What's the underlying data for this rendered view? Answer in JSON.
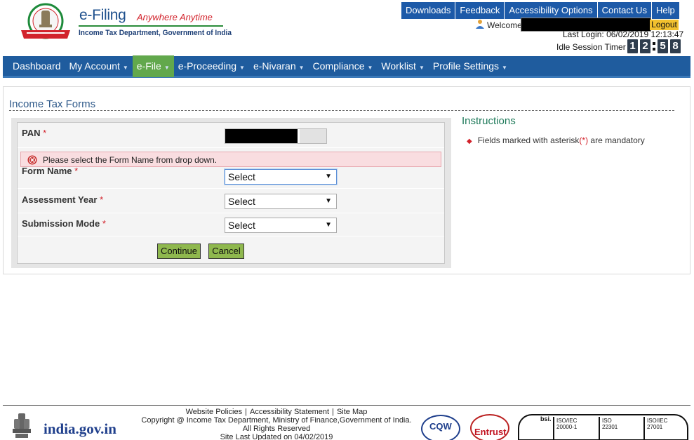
{
  "header": {
    "brand_title": "e-Filing",
    "brand_tagline": "Anywhere Anytime",
    "brand_sub": "Income Tax Department, Government of India",
    "top_links": [
      "Downloads",
      "Feedback",
      "Accessibility Options",
      "Contact Us",
      "Help"
    ],
    "welcome": "Welcome",
    "logout": "Logout",
    "last_login_label": "Last Login:",
    "last_login_value": "06/02/2019 12:13:47",
    "session_label": "Idle Session Timer",
    "timer_digits": [
      "1",
      "2",
      "5",
      "8"
    ]
  },
  "mainnav": {
    "items": [
      {
        "label": "Dashboard",
        "caret": false
      },
      {
        "label": "My Account",
        "caret": true
      },
      {
        "label": "e-File",
        "caret": true
      },
      {
        "label": "e-Proceeding",
        "caret": true
      },
      {
        "label": "e-Nivaran",
        "caret": true
      },
      {
        "label": "Compliance",
        "caret": true
      },
      {
        "label": "Worklist",
        "caret": true
      },
      {
        "label": "Profile Settings",
        "caret": true
      }
    ],
    "active_index": 2
  },
  "page": {
    "title": "Income Tax Forms"
  },
  "form": {
    "pan_label": "PAN",
    "required_mark": "*",
    "error_message": "Please select the Form Name from drop down.",
    "form_name_label": "Form Name",
    "form_name_value": "Select",
    "assessment_year_label": "Assessment Year",
    "assessment_year_value": "Select",
    "submission_mode_label": "Submission Mode",
    "submission_mode_value": "Select",
    "continue_label": "Continue",
    "cancel_label": "Cancel"
  },
  "instructions": {
    "title": "Instructions",
    "item_pre": "Fields marked with asterisk",
    "item_mark": "(*)",
    "item_post": " are mandatory"
  },
  "footer": {
    "links": [
      "Website Policies",
      "Accessibility Statement",
      "Site Map"
    ],
    "separator": "|",
    "copyright": "Copyright @ Income Tax Department, Ministry of Finance,Government of India.",
    "rights": "All Rights Reserved",
    "updated": "Site Last Updated on 04/02/2019",
    "india_gov": "india.gov.in",
    "cert_cqw": "CQW",
    "cert_entrust": "Entrust",
    "cert_bsi": "bsi.",
    "iso_1": [
      "ISO/IEC",
      "20000-1"
    ],
    "iso_2": [
      "ISO",
      "22301"
    ],
    "iso_3": [
      "ISO/IEC",
      "27001"
    ]
  },
  "colors": {
    "nav_blue": "#1f5c9e",
    "active_green": "#62a84c",
    "button_green": "#8fb84e",
    "error_pink": "#f9dde0",
    "required_red": "#d2222b"
  }
}
